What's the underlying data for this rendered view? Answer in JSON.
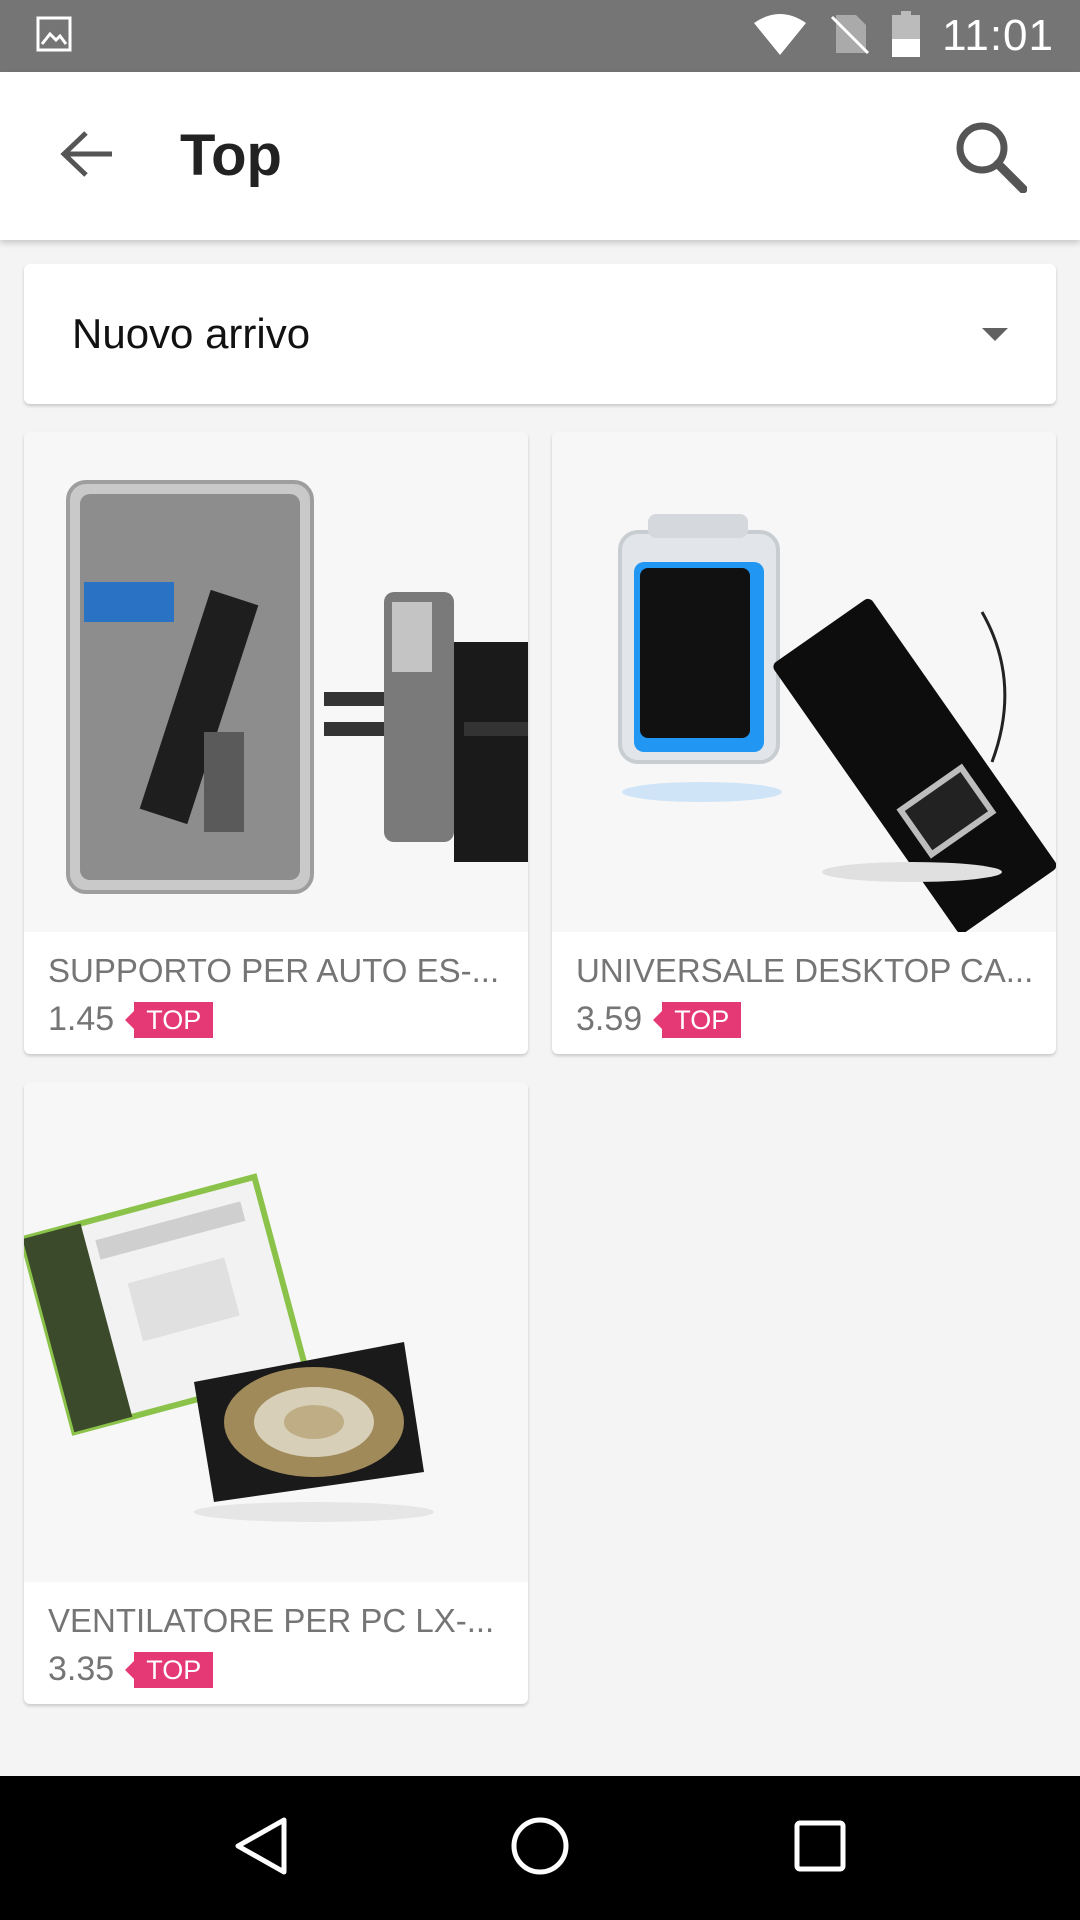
{
  "status_bar": {
    "time": "11:01",
    "icons": [
      "image-notification-icon",
      "wifi-icon",
      "no-sim-icon",
      "battery-icon"
    ]
  },
  "app_bar": {
    "title": "Top",
    "back_icon": "arrow-back-icon",
    "search_icon": "search-icon"
  },
  "sort": {
    "selected": "Nuovo arrivo",
    "icon": "dropdown-caret-icon"
  },
  "products": [
    {
      "name": "SUPPORTO PER AUTO ES-...",
      "price": "1.45",
      "badge": "TOP"
    },
    {
      "name": "UNIVERSALE DESKTOP CA...",
      "price": "3.59",
      "badge": "TOP"
    },
    {
      "name": "VENTILATORE PER PC LX-...",
      "price": "3.35",
      "badge": "TOP"
    }
  ],
  "nav_bar": {
    "icons": [
      "back-triangle-icon",
      "home-circle-icon",
      "recents-square-icon"
    ]
  },
  "colors": {
    "status_bar": "#757575",
    "badge": "#e53975",
    "background": "#f4f4f4"
  }
}
